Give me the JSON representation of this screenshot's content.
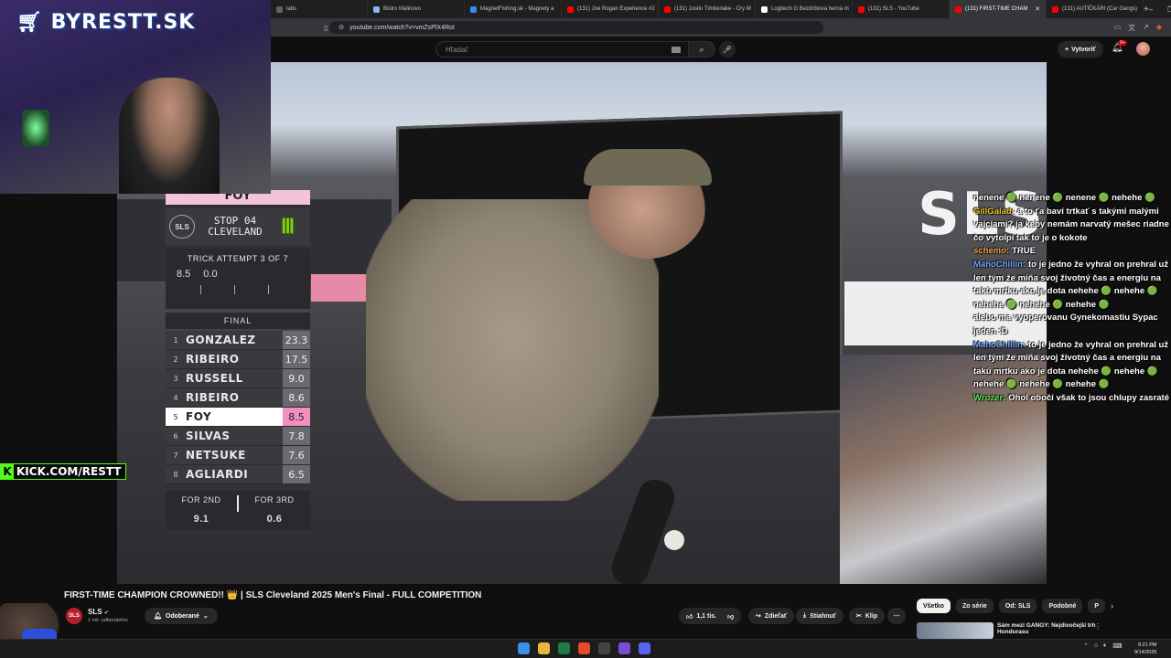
{
  "browser": {
    "tabs": [
      {
        "label": "labs",
        "color": "#5f6368"
      },
      {
        "label": "Bistro Malinovo",
        "color": "#8ab4f8"
      },
      {
        "label": "MagnetFishing.sk - Magnety a",
        "color": "#4285f4"
      },
      {
        "label": "(131) Joe Rogan Experience #2",
        "color": "#ff0000"
      },
      {
        "label": "(131) Justin Timberlake - Cry M",
        "color": "#ff0000"
      },
      {
        "label": "Logitech G Bezdrôtová herná m",
        "color": "#ffffff"
      },
      {
        "label": "(131) SLS - YouTube",
        "color": "#ff0000"
      },
      {
        "label": "(131) FIRST-TIME CHAM",
        "color": "#ff0000",
        "active": true
      },
      {
        "label": "(131) AUTÍČKÁRI (Car Gangs)",
        "color": "#ff0000"
      }
    ],
    "new_tab": "+",
    "window_controls": [
      "–",
      "❐",
      "✕"
    ],
    "url": "youtube.com/watch?v=vmZsPlX4RoI"
  },
  "youtube": {
    "search_placeholder": "Hľadať",
    "search_icon": "search-icon",
    "mic_icon": "mic-icon",
    "create_label": "Vytvoriť",
    "notif_badge": "9+"
  },
  "overlay": {
    "streamer_logo": "BYRESTT.SK",
    "kick_url": "KICK.COM/RESTT",
    "kick_letter": "K"
  },
  "scoreboard": {
    "current_rider": "FOY",
    "stop_line1": "STOP 04",
    "stop_line2": "CLEVELAND",
    "sls_logo": "SLS",
    "trick_header": "TRICK ATTEMPT 3 OF 7",
    "trick_scores": [
      "8.5",
      "0.0"
    ],
    "final_label": "FINAL",
    "rows": [
      {
        "pos": "1",
        "name": "GONZALEZ",
        "score": "23.3"
      },
      {
        "pos": "2",
        "name": "RIBEIRO",
        "score": "17.5"
      },
      {
        "pos": "3",
        "name": "RUSSELL",
        "score": "9.0"
      },
      {
        "pos": "4",
        "name": "RIBEIRO",
        "score": "8.6"
      },
      {
        "pos": "5",
        "name": "FOY",
        "score": "8.5"
      },
      {
        "pos": "6",
        "name": "SILVAS",
        "score": "7.8"
      },
      {
        "pos": "7",
        "name": "NETSUKE",
        "score": "7.6"
      },
      {
        "pos": "8",
        "name": "AGLIARDI",
        "score": "6.5"
      }
    ],
    "highlighted_pos": "5",
    "for2_label": "FOR 2ND",
    "for2_value": "9.1",
    "for3_label": "FOR 3RD",
    "for3_value": "0.6"
  },
  "chat": [
    {
      "user": "",
      "text": "nenene 🟢 nenene 🟢 nenene 🟢 nehehe 🟢",
      "color": "#ffffff"
    },
    {
      "user": "GillGalad:",
      "text": "a to ťa baví trtkať s takými malými vajciami? ja keby nemám narvatý mešec riadne čo vytolpí tak to je o kokote",
      "color": "#f2c230"
    },
    {
      "user": "schemo:",
      "text": "TRUE",
      "color": "#f2a540"
    },
    {
      "user": "MahoChillin:",
      "text": "to je jedno že vyhral on prehral už len tým že míňa svoj životný čas a energiu na takú mrtku ako je dota nehehe 🟢 nehehe 🟢 nehehe 🟢 nehehe 🟢 nehehe 🟢",
      "color": "#6fa8ff"
    },
    {
      "user": "",
      "text": "alebo ma vyoperovanu Gynekomastiu Sypac jeden :D",
      "color": "#ffffff"
    },
    {
      "user": "MahoChillin:",
      "text": "to je jedno že vyhral on prehral už len tým že míňa svoj životný čas a energiu na takú mrtku ako je dota nehehe 🟢 nehehe 🟢 nehehe 🟢 nehehe 🟢 nehehe 🟢",
      "color": "#6fa8ff"
    },
    {
      "user": "Wrozer:",
      "text": "Ohol obočí však to jsou chlupy zasraté",
      "color": "#5be35b"
    }
  ],
  "video_meta": {
    "title": "FIRST-TIME CHAMPION CROWNED!! 👑 | SLS Cleveland 2025 Men's Final - FULL COMPETITION",
    "channel": "SLS",
    "subs": "1 mil. odberateľov",
    "subscribed_label": "Odoberané",
    "like_count": "1,1 tis.",
    "share_label": "Zdieľať",
    "download_label": "Stiahnuť",
    "clip_label": "Klip",
    "more": "⋯"
  },
  "chips": [
    "Všetko",
    "Zo série",
    "Od: SLS",
    "Podobné",
    "P"
  ],
  "recommended": {
    "title": "Sám mezi GANGY: Nejdivočejší trh Hondurasu"
  },
  "taskbar": {
    "time": "9:21 PM",
    "date": "9/14/2025"
  },
  "video_overlay_text": "SLS"
}
